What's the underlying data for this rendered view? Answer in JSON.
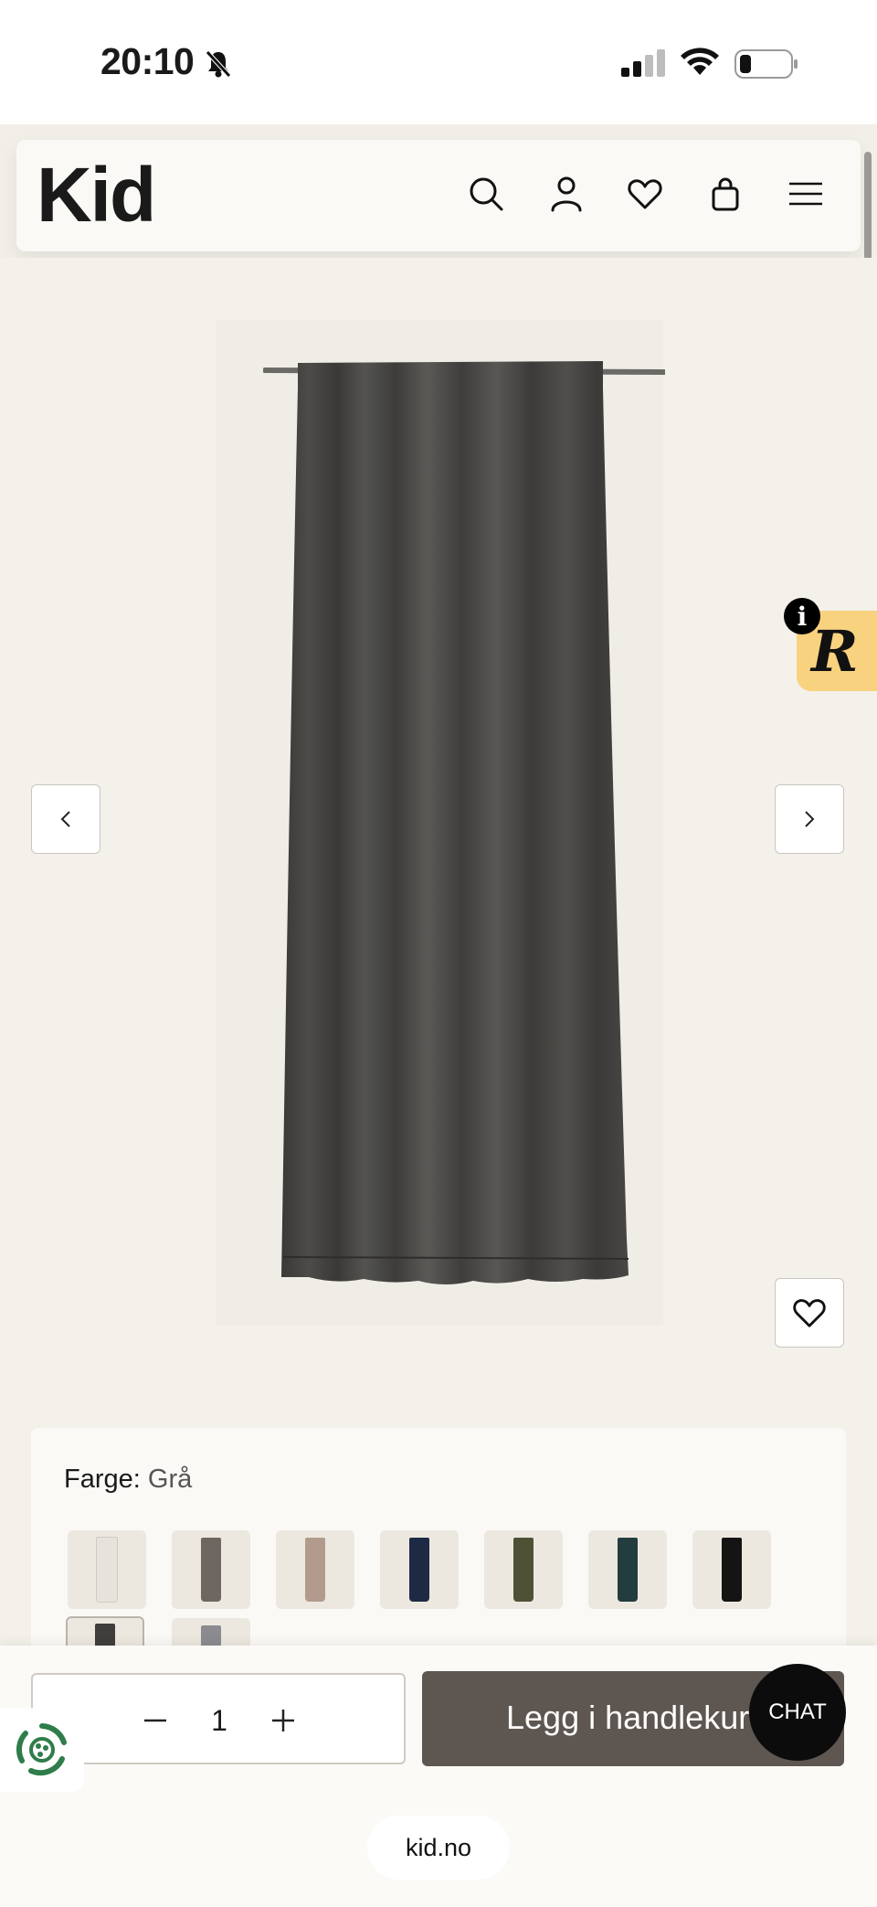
{
  "status_bar": {
    "time": "20:10"
  },
  "header": {
    "logo": "Kid"
  },
  "product": {
    "color_label": "Farge:",
    "color_value": "Grå",
    "swatches": [
      {
        "name": "white",
        "color": "#e6e3dd"
      },
      {
        "name": "taupe",
        "color": "#6e6660"
      },
      {
        "name": "rose-beige",
        "color": "#b29b8d"
      },
      {
        "name": "navy",
        "color": "#1e2a44"
      },
      {
        "name": "olive",
        "color": "#4f5136"
      },
      {
        "name": "dark-teal",
        "color": "#233c3e"
      },
      {
        "name": "black",
        "color": "#141414"
      },
      {
        "name": "grey",
        "color": "#3f3e3c",
        "selected": true
      },
      {
        "name": "light-grey",
        "color": "#8c8b90"
      }
    ]
  },
  "cart": {
    "quantity": "1",
    "add_label": "Legg i handlekurv"
  },
  "chat_label": "CHAT",
  "browser": {
    "url": "kid.no"
  },
  "colors": {
    "background": "#f4f1ea",
    "add_button": "#5e5650",
    "promo_tab": "#f8d27e",
    "eco_green": "#2e7d4a"
  }
}
